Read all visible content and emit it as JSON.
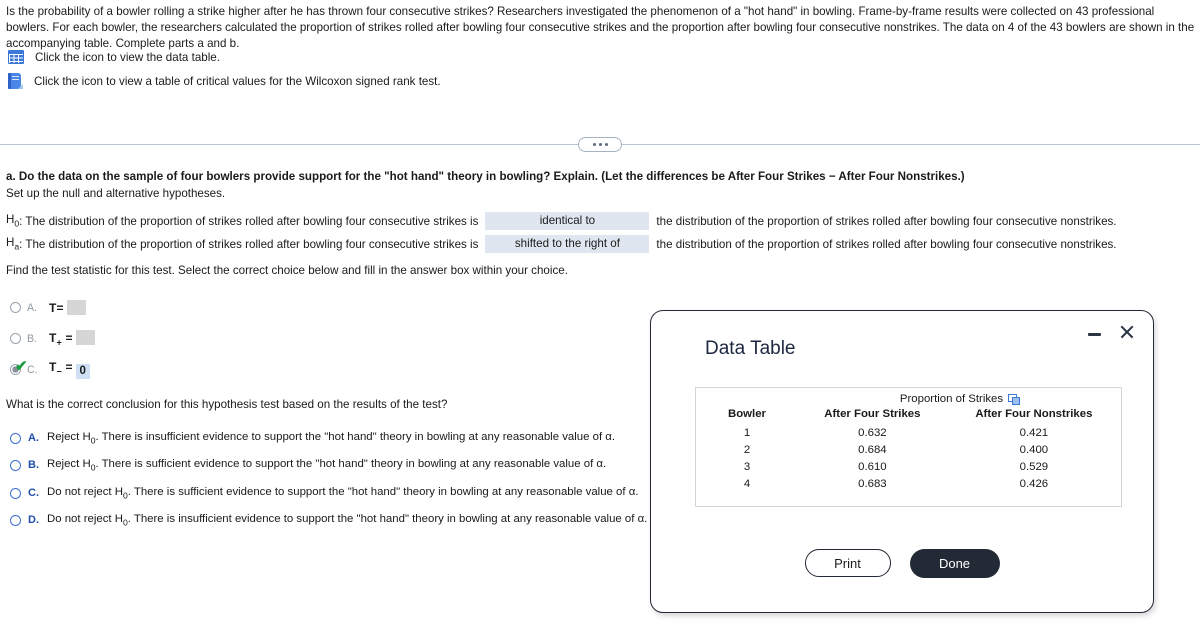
{
  "problem": {
    "statement": "Is the probability of a bowler rolling a strike higher after he has thrown four consecutive strikes? Researchers investigated the phenomenon of a \"hot hand\" in bowling. Frame-by-frame results were collected on 43 professional bowlers. For each bowler, the researchers calculated the proportion of strikes rolled after bowling four consecutive strikes and the proportion after bowling four consecutive nonstrikes. The data on 4 of the 43 bowlers are shown in the accompanying table. Complete parts a and b.",
    "link_data_table": "Click the icon to view the data table.",
    "link_critical_values": "Click the icon to view a table of critical values for the Wilcoxon signed rank test.",
    "icons": {
      "data_table": "grid-table-icon",
      "critical_values": "book-icon"
    }
  },
  "divider": {
    "dots_label": "..."
  },
  "part_a": {
    "prompt_line1": "a. Do the data on the sample of four bowlers provide support for the \"hot hand\" theory in bowling? Explain. (Let the differences be After Four Strikes − After Four Nonstrikes.)",
    "prompt_line2": "Set up the null and alternative hypotheses.",
    "hypotheses": [
      {
        "label": "H",
        "sub": "0",
        "pre": ": The distribution of the proportion of strikes rolled after bowling four consecutive strikes is",
        "selected": "identical to",
        "post": "the distribution of the proportion of strikes rolled after bowling four consecutive nonstrikes."
      },
      {
        "label": "H",
        "sub": "a",
        "pre": ": The distribution of the proportion of strikes rolled after bowling four consecutive strikes is",
        "selected": "shifted to the right of",
        "post": "the distribution of the proportion of strikes rolled after bowling four consecutive nonstrikes."
      }
    ],
    "find_statistic_prompt": "Find the test statistic for this test. Select the correct choice below and fill in the answer box within your choice.",
    "statistic_choices": [
      {
        "letter": "A.",
        "symbol": "T",
        "sub": "",
        "equals": "=",
        "value": "",
        "state": "unselected",
        "dim": true
      },
      {
        "letter": "B.",
        "symbol": "T",
        "sub": "+",
        "equals": "=",
        "value": "",
        "state": "unselected",
        "dim": true
      },
      {
        "letter": "C.",
        "symbol": "T",
        "sub": "−",
        "equals": "=",
        "value": "0",
        "state": "selected-correct",
        "dim": true
      }
    ]
  },
  "conclusion": {
    "question": "What is the correct conclusion for this hypothesis test based on the results of the test?",
    "choices": [
      {
        "letter": "A.",
        "text_pre": "Reject H",
        "sub": "0",
        "text_post": ". There is insufficient evidence to support the \"hot hand\" theory in bowling at any reasonable value of α."
      },
      {
        "letter": "B.",
        "text_pre": "Reject H",
        "sub": "0",
        "text_post": ". There is sufficient evidence to support the \"hot hand\" theory in bowling at any reasonable value of α."
      },
      {
        "letter": "C.",
        "text_pre": "Do not reject H",
        "sub": "0",
        "text_post": ". There is sufficient evidence to support the \"hot hand\" theory in bowling at any reasonable value of α."
      },
      {
        "letter": "D.",
        "text_pre": "Do not reject H",
        "sub": "0",
        "text_post": ". There is insufficient evidence to support the \"hot hand\" theory in bowling at any reasonable value of α."
      }
    ]
  },
  "dialog": {
    "title": "Data Table",
    "minimize_label": "minimize",
    "close_label": "close",
    "table": {
      "span_header": "Proportion of Strikes",
      "copy_icon": "copy-icon",
      "columns": [
        "Bowler",
        "After Four Strikes",
        "After Four Nonstrikes"
      ],
      "rows": [
        [
          "1",
          "0.632",
          "0.421"
        ],
        [
          "2",
          "0.684",
          "0.400"
        ],
        [
          "3",
          "0.610",
          "0.529"
        ],
        [
          "4",
          "0.683",
          "0.426"
        ]
      ]
    },
    "buttons": {
      "print": "Print",
      "done": "Done"
    }
  },
  "colors": {
    "accent_blue": "#3b78d8",
    "answer_box_bg": "#dfe6ef",
    "filled_box_bg": "#cfe0f5",
    "dialog_border": "#222a35",
    "check_green": "#1a9e3e",
    "done_button_bg": "#222a35"
  }
}
